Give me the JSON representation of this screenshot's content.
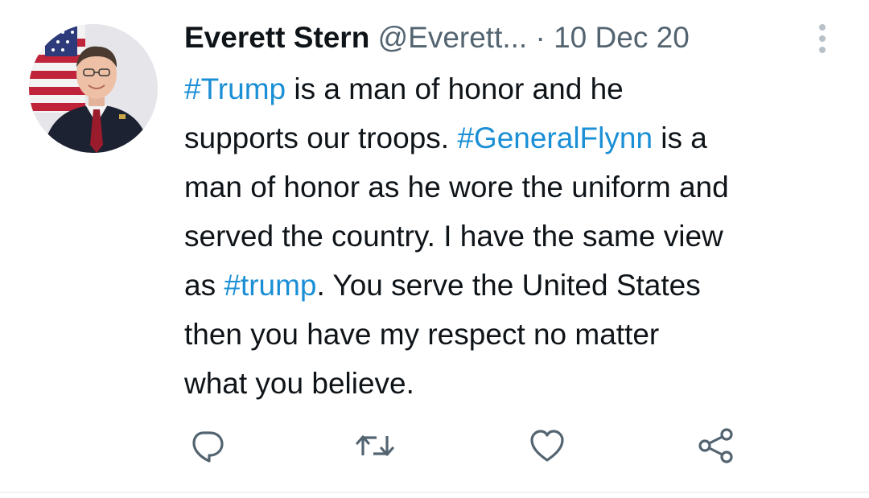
{
  "tweet": {
    "author_name": "Everett Stern",
    "handle": "@Everett...",
    "separator": "·",
    "date": "10 Dec 20",
    "lines": [
      [
        {
          "t": "#Trump",
          "tag": true
        },
        {
          "t": " is a man of honor and he",
          "tag": false
        }
      ],
      [
        {
          "t": "supports our troops. ",
          "tag": false
        },
        {
          "t": "#GeneralFlynn",
          "tag": true
        },
        {
          "t": " is a",
          "tag": false
        }
      ],
      [
        {
          "t": "man of honor as he wore the uniform and",
          "tag": false
        }
      ],
      [
        {
          "t": "served the country. I have the same view",
          "tag": false
        }
      ],
      [
        {
          "t": "as ",
          "tag": false
        },
        {
          "t": "#trump",
          "tag": true
        },
        {
          "t": ". You serve the United States",
          "tag": false
        }
      ],
      [
        {
          "t": "then you have my respect no matter",
          "tag": false
        }
      ],
      [
        {
          "t": "what you believe.",
          "tag": false
        }
      ]
    ]
  },
  "actions": {
    "reply_icon": "reply-icon",
    "retweet_icon": "retweet-icon",
    "like_icon": "like-icon",
    "share_icon": "share-icon"
  },
  "colors": {
    "hashtag": "#1b8fd6",
    "text": "#0f1419",
    "secondary": "#536471",
    "icon": "#536471"
  }
}
